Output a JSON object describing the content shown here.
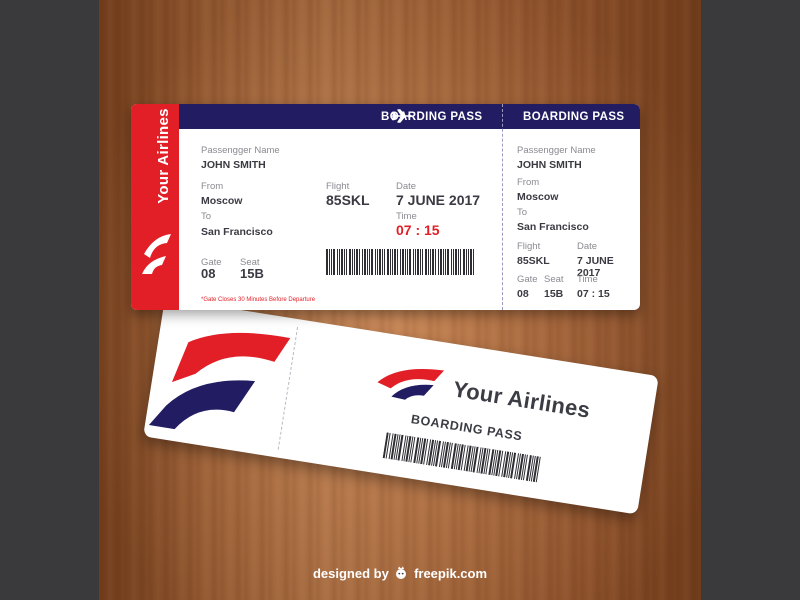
{
  "front_ticket": {
    "brand": "Your Airlines",
    "header_label_main": "BOARDING PASS",
    "header_label_stub": "BOARDING PASS",
    "passenger_label": "Passengger Name",
    "passenger_value": "JOHN SMITH",
    "from_label": "From",
    "from_value": "Moscow",
    "to_label": "To",
    "to_value": "San Francisco",
    "gate_label": "Gate",
    "gate_value": "08",
    "seat_label": "Seat",
    "seat_value": "15B",
    "flight_label": "Flight",
    "flight_value": "85SKL",
    "date_label": "Date",
    "date_value": "7 JUNE 2017",
    "time_label": "Time",
    "time_value": "07 : 15",
    "note": "*Gate Closes 30 Minutes Before Departure"
  },
  "stub": {
    "passenger_label": "Passengger Name",
    "passenger_value": "JOHN SMITH",
    "from_label": "From",
    "from_value": "Moscow",
    "to_label": "To",
    "to_value": "San Francisco",
    "flight_label": "Flight",
    "flight_value": "85SKL",
    "date_label": "Date",
    "date_value": "7 JUNE 2017",
    "gate_label": "Gate",
    "gate_value": "08",
    "seat_label": "Seat",
    "seat_value": "15B",
    "time_label": "Time",
    "time_value": "07 : 15"
  },
  "back_ticket": {
    "brand": "Your Airlines",
    "pass_label": "BOARDING PASS"
  },
  "footer": {
    "prefix": "designed by",
    "site": "freepik.com"
  },
  "colors": {
    "brand_red": "#e21f26",
    "brand_navy": "#221d63",
    "wood": "#b06a3a"
  },
  "icons": [
    "airplane-icon",
    "airline-logo-icon",
    "barcode-icon",
    "freepik-logo-icon"
  ]
}
